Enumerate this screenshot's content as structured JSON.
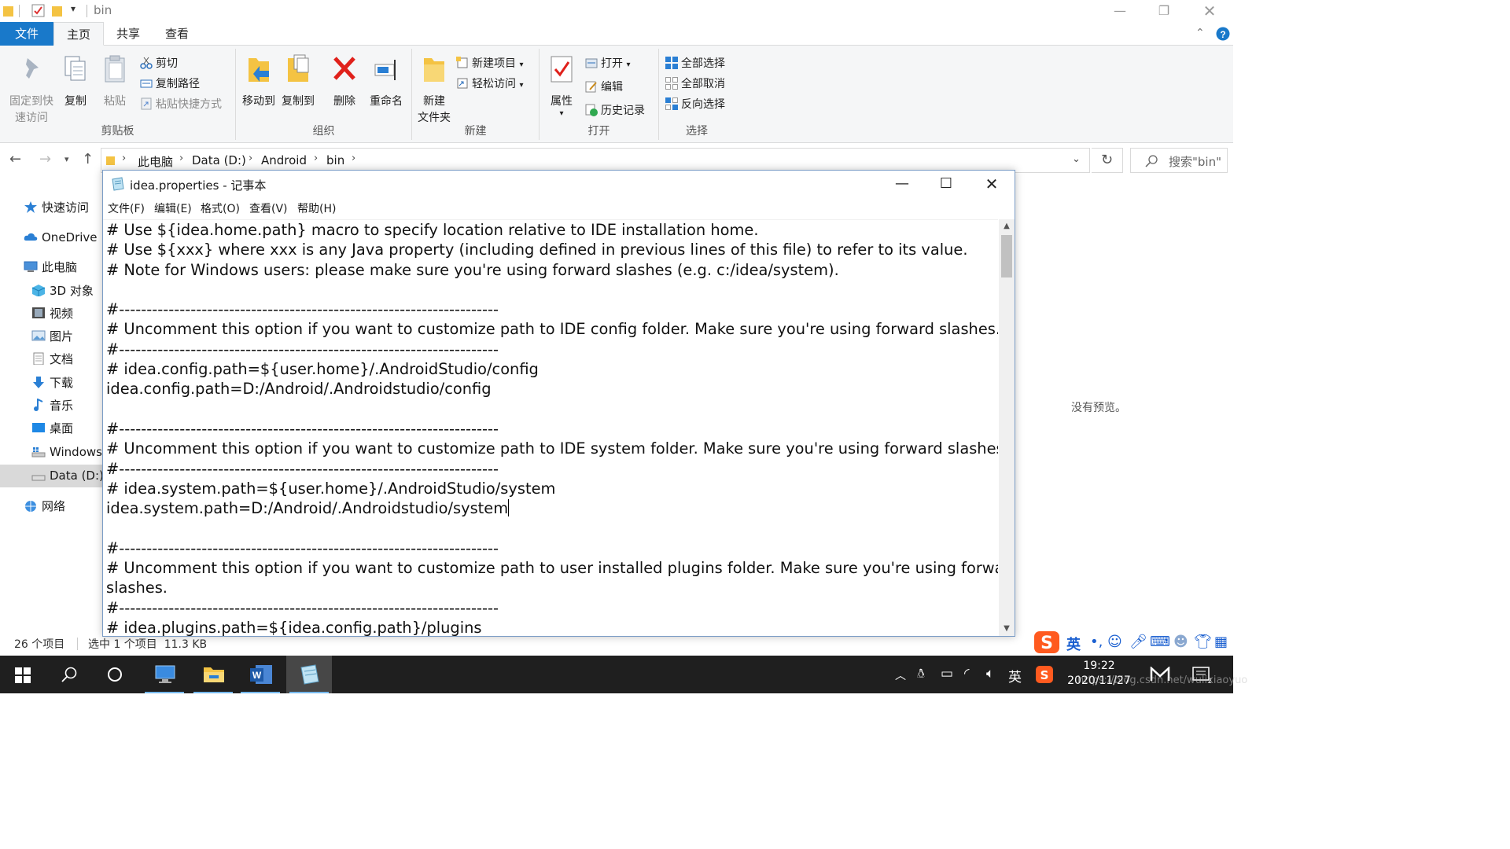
{
  "explorer": {
    "title": "bin",
    "tabs": {
      "file": "文件",
      "home": "主页",
      "share": "共享",
      "view": "查看"
    },
    "ribbon": {
      "clipboard": {
        "label": "剪贴板",
        "pin_line1": "固定到快",
        "pin_line2": "速访问",
        "copy": "复制",
        "paste": "粘贴",
        "cut": "剪切",
        "copy_path": "复制路径",
        "paste_shortcut": "粘贴快捷方式"
      },
      "organize": {
        "label": "组织",
        "move_to": "移动到",
        "copy_to": "复制到",
        "delete": "删除",
        "rename": "重命名"
      },
      "new": {
        "label": "新建",
        "new_folder_line1": "新建",
        "new_folder_line2": "文件夹",
        "new_item": "新建项目",
        "easy_access": "轻松访问"
      },
      "open": {
        "label": "打开",
        "properties": "属性",
        "open": "打开",
        "edit": "编辑",
        "history": "历史记录"
      },
      "select": {
        "label": "选择",
        "select_all": "全部选择",
        "select_none": "全部取消",
        "invert": "反向选择"
      }
    },
    "breadcrumb": [
      "此电脑",
      "Data (D:)",
      "Android",
      "bin"
    ],
    "search_placeholder": "搜索\"bin\"",
    "nav": {
      "quick_access": "快速访问",
      "onedrive": "OneDrive",
      "this_pc": "此电脑",
      "items": [
        "3D 对象",
        "视频",
        "图片",
        "文档",
        "下载",
        "音乐",
        "桌面",
        "Windows",
        "Data (D:)"
      ],
      "network": "网络"
    },
    "preview_text": "没有预览。",
    "status": {
      "count": "26 个项目",
      "selected": "选中 1 个项目  11.3 KB"
    }
  },
  "notepad": {
    "title": "idea.properties - 记事本",
    "menu": [
      "文件(F)",
      "编辑(E)",
      "格式(O)",
      "查看(V)",
      "帮助(H)"
    ],
    "lines": [
      "# Use ${idea.home.path} macro to specify location relative to IDE installation home.",
      "# Use ${xxx} where xxx is any Java property (including defined in previous lines of this file) to refer to its value.",
      "# Note for Windows users: please make sure you're using forward slashes (e.g. c:/idea/system).",
      "",
      "#---------------------------------------------------------------------",
      "# Uncomment this option if you want to customize path to IDE config folder. Make sure you're using forward slashes.",
      "#---------------------------------------------------------------------",
      "# idea.config.path=${user.home}/.AndroidStudio/config",
      "idea.config.path=D:/Android/.Androidstudio/config",
      "",
      "#---------------------------------------------------------------------",
      "# Uncomment this option if you want to customize path to IDE system folder. Make sure you're using forward slashes.",
      "#---------------------------------------------------------------------",
      "# idea.system.path=${user.home}/.AndroidStudio/system",
      "idea.system.path=D:/Android/.Androidstudio/system",
      "",
      "#---------------------------------------------------------------------",
      "# Uncomment this option if you want to customize path to user installed plugins folder. Make sure you're using forward",
      "slashes.",
      "#---------------------------------------------------------------------",
      "# idea.plugins.path=${idea.config.path}/plugins"
    ]
  },
  "ime": {
    "lang": "英"
  },
  "taskbar": {
    "tray_lang": "英",
    "time": "19:22",
    "date": "2020/11/27",
    "watermark": "https://blog.csdn.net/wulixiaoyuo"
  },
  "colors": {
    "file_tab": "#1979ca",
    "taskbar": "#1f1f1f",
    "accent": "#76b9ed"
  }
}
